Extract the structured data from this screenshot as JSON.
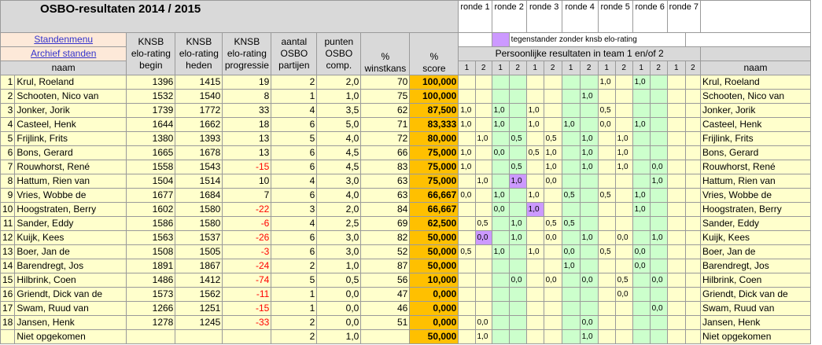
{
  "title": "OSBO-resultaten 2014 / 2015",
  "links": {
    "standenmenu": "Standenmenu",
    "archief": "Archief standen"
  },
  "headers": {
    "naam": "naam",
    "knsb_begin": [
      "KNSB",
      "elo-rating",
      "begin"
    ],
    "knsb_heden": [
      "KNSB",
      "elo-rating",
      "heden"
    ],
    "knsb_prog": [
      "KNSB",
      "elo-rating",
      "progressie"
    ],
    "aantal": [
      "aantal",
      "OSBO",
      "partijen"
    ],
    "punten": [
      "punten",
      "OSBO",
      "comp."
    ],
    "winst": [
      "%",
      "winstkans"
    ],
    "score": [
      "%",
      "score"
    ],
    "naam_right": "naam"
  },
  "rondes": [
    "ronde 1",
    "ronde 2",
    "ronde 3",
    "ronde 4",
    "ronde 5",
    "ronde 6",
    "ronde 7"
  ],
  "legend": "tegenstander zonder knsb elo-rating",
  "persoonlijk": "Persoonlijke resultaten in team 1 en/of 2",
  "sub_cols": [
    "1",
    "2",
    "1",
    "2",
    "1",
    "2",
    "1",
    "2",
    "1",
    "2",
    "1",
    "2",
    "1",
    "2"
  ],
  "colors": {
    "score": "#ffc000",
    "yellow": "#ffffcc",
    "green": "#ccffcc",
    "purple": "#cc99ff",
    "negative": "#ff0000"
  },
  "rows": [
    {
      "nr": "1",
      "naam": "Krul, Roeland",
      "begin": "1396",
      "heden": "1415",
      "prog": "19",
      "neg": false,
      "aantal": "2",
      "punten": "2,0",
      "winst": "70",
      "score": "100,000",
      "r": [
        "",
        "",
        "",
        "",
        "",
        "",
        "",
        "",
        "1,0",
        "",
        "1,0",
        "",
        "",
        ""
      ],
      "p": []
    },
    {
      "nr": "2",
      "naam": "Schooten, Nico van",
      "begin": "1532",
      "heden": "1540",
      "prog": "8",
      "neg": false,
      "aantal": "1",
      "punten": "1,0",
      "winst": "75",
      "score": "100,000",
      "r": [
        "",
        "",
        "",
        "",
        "",
        "",
        "",
        "1,0",
        "",
        "",
        "",
        "",
        "",
        ""
      ],
      "p": []
    },
    {
      "nr": "3",
      "naam": "Jonker, Jorik",
      "begin": "1739",
      "heden": "1772",
      "prog": "33",
      "neg": false,
      "aantal": "4",
      "punten": "3,5",
      "winst": "62",
      "score": "87,500",
      "r": [
        "1,0",
        "",
        "1,0",
        "",
        "1,0",
        "",
        "",
        "",
        "0,5",
        "",
        "",
        "",
        "",
        ""
      ],
      "p": []
    },
    {
      "nr": "4",
      "naam": "Casteel, Henk",
      "begin": "1644",
      "heden": "1662",
      "prog": "18",
      "neg": false,
      "aantal": "6",
      "punten": "5,0",
      "winst": "71",
      "score": "83,333",
      "r": [
        "1,0",
        "",
        "1,0",
        "",
        "1,0",
        "",
        "1,0",
        "",
        "0,0",
        "",
        "1,0",
        "",
        "",
        ""
      ],
      "p": []
    },
    {
      "nr": "5",
      "naam": "Frijlink, Frits",
      "begin": "1380",
      "heden": "1393",
      "prog": "13",
      "neg": false,
      "aantal": "5",
      "punten": "4,0",
      "winst": "72",
      "score": "80,000",
      "r": [
        "",
        "1,0",
        "",
        "0,5",
        "",
        "0,5",
        "",
        "1,0",
        "",
        "1,0",
        "",
        "",
        "",
        ""
      ],
      "p": []
    },
    {
      "nr": "6",
      "naam": "Bons, Gerard",
      "begin": "1665",
      "heden": "1678",
      "prog": "13",
      "neg": false,
      "aantal": "6",
      "punten": "4,5",
      "winst": "66",
      "score": "75,000",
      "r": [
        "1,0",
        "",
        "0,0",
        "",
        "0,5",
        "1,0",
        "",
        "1,0",
        "",
        "1,0",
        "",
        "",
        "",
        ""
      ],
      "p": []
    },
    {
      "nr": "7",
      "naam": "Rouwhorst, René",
      "begin": "1558",
      "heden": "1543",
      "prog": "-15",
      "neg": true,
      "aantal": "6",
      "punten": "4,5",
      "winst": "83",
      "score": "75,000",
      "r": [
        "1,0",
        "",
        "",
        "0,5",
        "",
        "1,0",
        "",
        "1,0",
        "",
        "1,0",
        "",
        "0,0",
        "",
        ""
      ],
      "p": []
    },
    {
      "nr": "8",
      "naam": "Hattum, Rien van",
      "begin": "1504",
      "heden": "1514",
      "prog": "10",
      "neg": false,
      "aantal": "4",
      "punten": "3,0",
      "winst": "63",
      "score": "75,000",
      "r": [
        "",
        "1,0",
        "",
        "1,0",
        "",
        "0,0",
        "",
        "",
        "",
        "",
        "",
        "1,0",
        "",
        ""
      ],
      "p": [
        3
      ]
    },
    {
      "nr": "9",
      "naam": "Vries, Wobbe de",
      "begin": "1677",
      "heden": "1684",
      "prog": "7",
      "neg": false,
      "aantal": "6",
      "punten": "4,0",
      "winst": "63",
      "score": "66,667",
      "r": [
        "0,0",
        "",
        "1,0",
        "",
        "1,0",
        "",
        "0,5",
        "",
        "0,5",
        "",
        "1,0",
        "",
        "",
        ""
      ],
      "p": []
    },
    {
      "nr": "10",
      "naam": "Hoogstraten, Berry",
      "begin": "1602",
      "heden": "1580",
      "prog": "-22",
      "neg": true,
      "aantal": "3",
      "punten": "2,0",
      "winst": "84",
      "score": "66,667",
      "r": [
        "",
        "",
        "0,0",
        "",
        "1,0",
        "",
        "",
        "",
        "",
        "",
        "1,0",
        "",
        "",
        ""
      ],
      "p": [
        4
      ]
    },
    {
      "nr": "11",
      "naam": "Sander, Eddy",
      "begin": "1586",
      "heden": "1580",
      "prog": "-6",
      "neg": true,
      "aantal": "4",
      "punten": "2,5",
      "winst": "69",
      "score": "62,500",
      "r": [
        "",
        "0,5",
        "",
        "1,0",
        "",
        "0,5",
        "0,5",
        "",
        "",
        "",
        "",
        "",
        "",
        ""
      ],
      "p": []
    },
    {
      "nr": "12",
      "naam": "Kuijk, Kees",
      "begin": "1563",
      "heden": "1537",
      "prog": "-26",
      "neg": true,
      "aantal": "6",
      "punten": "3,0",
      "winst": "82",
      "score": "50,000",
      "r": [
        "",
        "0,0",
        "",
        "1,0",
        "",
        "0,0",
        "",
        "1,0",
        "",
        "0,0",
        "",
        "1,0",
        "",
        ""
      ],
      "p": [
        1
      ]
    },
    {
      "nr": "13",
      "naam": "Boer, Jan de",
      "begin": "1508",
      "heden": "1505",
      "prog": "-3",
      "neg": true,
      "aantal": "6",
      "punten": "3,0",
      "winst": "52",
      "score": "50,000",
      "r": [
        "0,5",
        "",
        "1,0",
        "",
        "1,0",
        "",
        "0,0",
        "",
        "0,5",
        "",
        "0,0",
        "",
        "",
        ""
      ],
      "p": []
    },
    {
      "nr": "14",
      "naam": "Barendregt, Jos",
      "begin": "1891",
      "heden": "1867",
      "prog": "-24",
      "neg": true,
      "aantal": "2",
      "punten": "1,0",
      "winst": "87",
      "score": "50,000",
      "r": [
        "",
        "",
        "",
        "",
        "",
        "",
        "1,0",
        "",
        "",
        "",
        "0,0",
        "",
        "",
        ""
      ],
      "p": []
    },
    {
      "nr": "15",
      "naam": "Hilbrink, Coen",
      "begin": "1486",
      "heden": "1412",
      "prog": "-74",
      "neg": true,
      "aantal": "5",
      "punten": "0,5",
      "winst": "56",
      "score": "10,000",
      "r": [
        "",
        "",
        "",
        "0,0",
        "",
        "0,0",
        "",
        "0,0",
        "",
        "0,5",
        "",
        "0,0",
        "",
        ""
      ],
      "p": []
    },
    {
      "nr": "16",
      "naam": "Griendt, Dick van de",
      "begin": "1573",
      "heden": "1562",
      "prog": "-11",
      "neg": true,
      "aantal": "1",
      "punten": "0,0",
      "winst": "47",
      "score": "0,000",
      "r": [
        "",
        "",
        "",
        "",
        "",
        "",
        "",
        "",
        "",
        "0,0",
        "",
        "",
        "",
        ""
      ],
      "p": []
    },
    {
      "nr": "17",
      "naam": "Swam, Ruud van",
      "begin": "1266",
      "heden": "1251",
      "prog": "-15",
      "neg": true,
      "aantal": "1",
      "punten": "0,0",
      "winst": "46",
      "score": "0,000",
      "r": [
        "",
        "",
        "",
        "",
        "",
        "",
        "",
        "",
        "",
        "",
        "",
        "0,0",
        "",
        ""
      ],
      "p": []
    },
    {
      "nr": "18",
      "naam": "Jansen, Henk",
      "begin": "1278",
      "heden": "1245",
      "prog": "-33",
      "neg": true,
      "aantal": "2",
      "punten": "0,0",
      "winst": "51",
      "score": "0,000",
      "r": [
        "",
        "0,0",
        "",
        "",
        "",
        "",
        "",
        "0,0",
        "",
        "",
        "",
        "",
        "",
        ""
      ],
      "p": []
    },
    {
      "nr": "",
      "naam": "Niet opgekomen",
      "begin": "",
      "heden": "",
      "prog": "",
      "neg": false,
      "aantal": "2",
      "punten": "1,0",
      "winst": "",
      "score": "50,000",
      "r": [
        "",
        "1,0",
        "",
        "",
        "",
        "",
        "",
        "1,0",
        "",
        "",
        "",
        "",
        "",
        ""
      ],
      "p": []
    }
  ]
}
